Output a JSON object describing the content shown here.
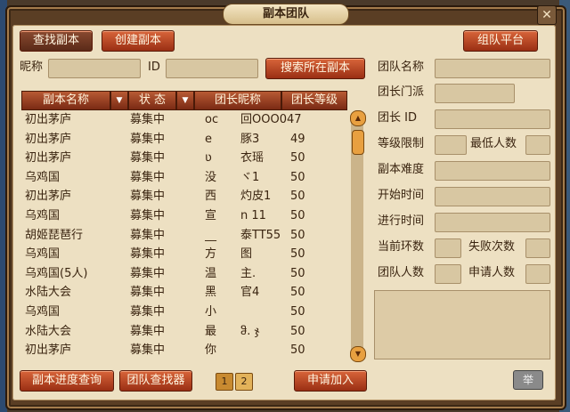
{
  "window": {
    "title": "副本团队",
    "close": "✕"
  },
  "top_buttons": {
    "find": "查找副本",
    "create": "创建副本",
    "platform": "组队平台"
  },
  "search": {
    "nickname_label": "昵称",
    "id_label": "ID",
    "search_button": "搜索所在副本",
    "nickname_value": "",
    "id_value": ""
  },
  "table": {
    "headers": [
      "副本名称",
      "状 态",
      "团长昵称",
      "团长等级"
    ],
    "rows": [
      [
        "初出茅庐",
        "募集中",
        "oc",
        "回OOO047"
      ],
      [
        "初出茅庐",
        "募集中",
        "e",
        "豚3",
        "49"
      ],
      [
        "初出茅庐",
        "募集中",
        "ʋ",
        "衣瑶",
        "50"
      ],
      [
        "乌鸡国",
        "募集中",
        "没",
        "ヾ1",
        "50"
      ],
      [
        "初出茅庐",
        "募集中",
        "西",
        "灼皮1",
        "50"
      ],
      [
        "乌鸡国",
        "募集中",
        "宣",
        "n 11",
        "50"
      ],
      [
        "胡姬琵琶行",
        "募集中",
        "__",
        "泰TT55",
        "50"
      ],
      [
        "乌鸡国",
        "募集中",
        "方",
        "图",
        "50"
      ],
      [
        "乌鸡国(5人)",
        "募集中",
        "温",
        "主.",
        "50"
      ],
      [
        "水陆大会",
        "募集中",
        "黑",
        "官4",
        "50"
      ],
      [
        "乌鸡国",
        "募集中",
        "小",
        "",
        "50"
      ],
      [
        "水陆大会",
        "募集中",
        "最",
        "ჵ. ჯ",
        "50"
      ],
      [
        "初出茅庐",
        "募集中",
        "你",
        "",
        "50"
      ]
    ]
  },
  "details": {
    "team_name": "团队名称",
    "leader_school": "团长门派",
    "leader_id": "团长 ID",
    "level_limit": "等级限制",
    "min_people": "最低人数",
    "difficulty": "副本难度",
    "start_time": "开始时间",
    "elapsed_time": "进行时间",
    "current_round": "当前环数",
    "fail_count": "失败次数",
    "team_size": "团队人数",
    "applicants": "申请人数"
  },
  "bottom": {
    "progress": "副本进度查询",
    "finder": "团队查找器",
    "pages": [
      "1",
      "2"
    ],
    "apply": "申请加入",
    "report": "举"
  }
}
